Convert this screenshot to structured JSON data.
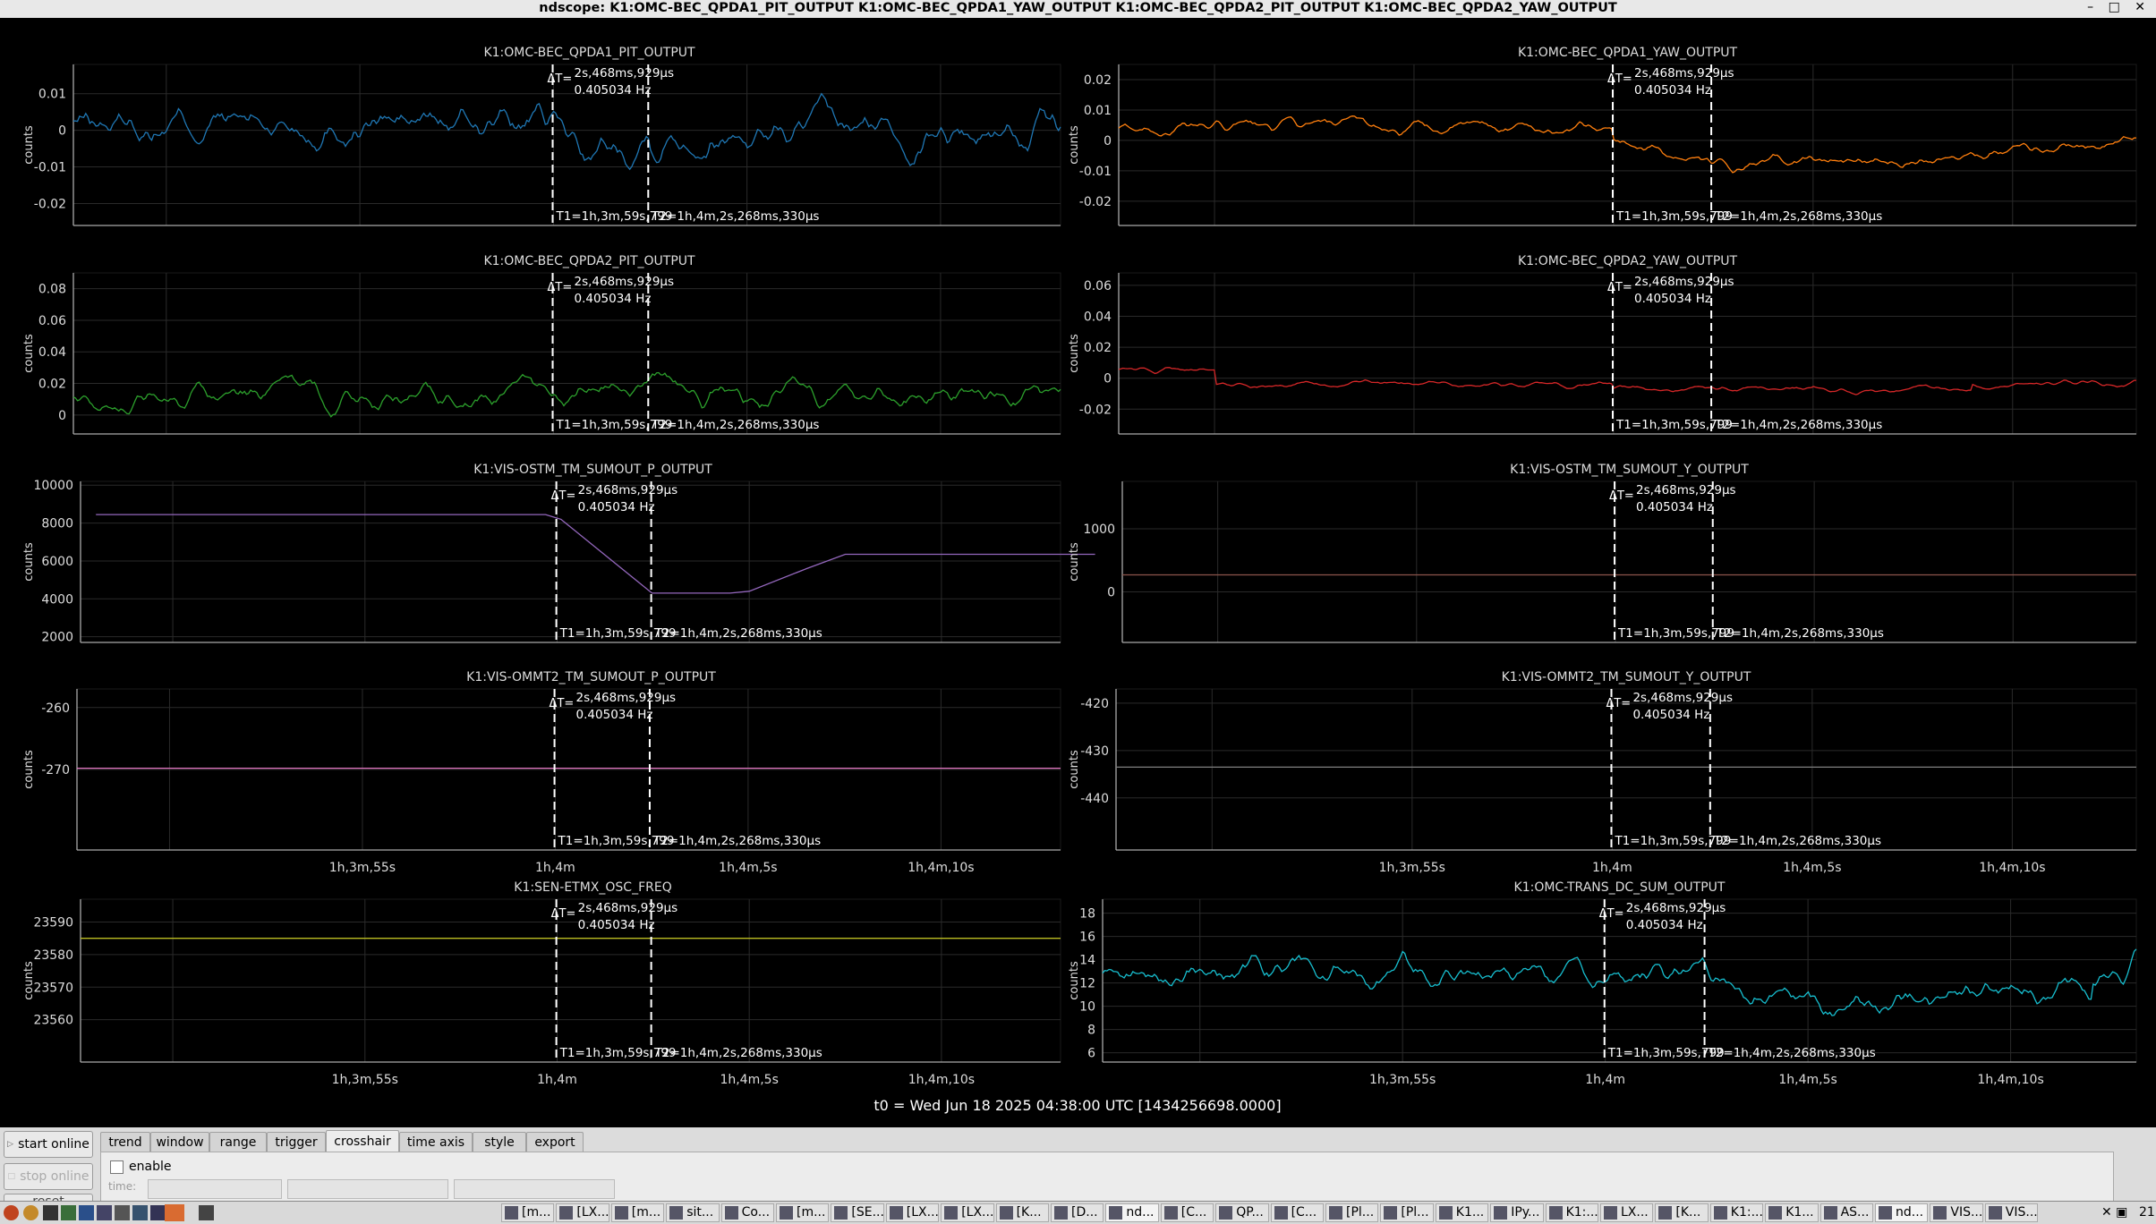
{
  "window": {
    "title": "ndscope: K1:OMC-BEC_QPDA1_PIT_OUTPUT K1:OMC-BEC_QPDA1_YAW_OUTPUT K1:OMC-BEC_QPDA2_PIT_OUTPUT K1:OMC-BEC_QPDA2_YAW_OUTPUT",
    "controls": "– □ ✕"
  },
  "colors": {
    "blue": "#1f77b4",
    "orange": "#ff7f0e",
    "green": "#2ca02c",
    "red": "#d62728",
    "purple": "#9467bd",
    "brown": "#8c564b",
    "pink": "#e377c2",
    "gray": "#7f7f7f",
    "olive": "#bcbd22",
    "cyan": "#17becf"
  },
  "crosshair": {
    "delta_label": "ΔT=",
    "delta": "2s,468ms,929µs",
    "freq": "0.405034 Hz",
    "t1": "T1=1h,3m,59s,799",
    "t2": "T2=1h,4m,2s,268ms,330µs"
  },
  "axis_label": "counts",
  "time_ticks": [
    "1h,3m,55s",
    "1h,4m",
    "1h,4m,5s",
    "1h,4m,10s"
  ],
  "t0": "t0 = Wed Jun 18 2025 04:38:00 UTC [1434256698.0000]",
  "chart_data": [
    {
      "type": "line",
      "title": "K1:OMC-BEC_QPDA1_PIT_OUTPUT",
      "series": [
        {
          "name": "K1:OMC-BEC_QPDA1_PIT_OUTPUT",
          "color": "blue",
          "shape": "qpd_pit1",
          "base": 0.002,
          "amp": 0.01
        }
      ],
      "yticks": [
        {
          "v": 0.01,
          "l": "0.01"
        },
        {
          "v": 0,
          "l": "0"
        },
        {
          "v": -0.01,
          "l": "-0.01"
        },
        {
          "v": -0.02,
          "l": "-0.02"
        }
      ],
      "ylim": [
        -0.026,
        0.018
      ],
      "xlabel": "",
      "ylabel": "counts"
    },
    {
      "type": "line",
      "title": "K1:OMC-BEC_QPDA1_YAW_OUTPUT",
      "series": [
        {
          "name": "K1:OMC-BEC_QPDA1_YAW_OUTPUT",
          "color": "orange",
          "shape": "qpd_yaw1",
          "base": 0.004,
          "amp": 0.004
        }
      ],
      "yticks": [
        {
          "v": 0.02,
          "l": "0.02"
        },
        {
          "v": 0.01,
          "l": "0.01"
        },
        {
          "v": 0,
          "l": "0"
        },
        {
          "v": -0.01,
          "l": "-0.01"
        },
        {
          "v": -0.02,
          "l": "-0.02"
        }
      ],
      "ylim": [
        -0.028,
        0.025
      ],
      "xlabel": "",
      "ylabel": "counts"
    },
    {
      "type": "line",
      "title": "K1:OMC-BEC_QPDA2_PIT_OUTPUT",
      "series": [
        {
          "name": "K1:OMC-BEC_QPDA2_PIT_OUTPUT",
          "color": "green",
          "shape": "qpd_pit2",
          "base": 0.012,
          "amp": 0.015
        }
      ],
      "yticks": [
        {
          "v": 0.08,
          "l": "0.08"
        },
        {
          "v": 0.06,
          "l": "0.06"
        },
        {
          "v": 0.04,
          "l": "0.04"
        },
        {
          "v": 0.02,
          "l": "0.02"
        },
        {
          "v": 0,
          "l": "0"
        }
      ],
      "ylim": [
        -0.012,
        0.09
      ],
      "xlabel": "",
      "ylabel": "counts"
    },
    {
      "type": "line",
      "title": "K1:OMC-BEC_QPDA2_YAW_OUTPUT",
      "series": [
        {
          "name": "K1:OMC-BEC_QPDA2_YAW_OUTPUT",
          "color": "red",
          "shape": "qpd_yaw2",
          "base": -0.004,
          "amp": 0.004
        }
      ],
      "yticks": [
        {
          "v": 0.06,
          "l": "0.06"
        },
        {
          "v": 0.04,
          "l": "0.04"
        },
        {
          "v": 0.02,
          "l": "0.02"
        },
        {
          "v": 0,
          "l": "0"
        },
        {
          "v": -0.02,
          "l": "-0.02"
        }
      ],
      "ylim": [
        -0.036,
        0.068
      ],
      "xlabel": "",
      "ylabel": "counts"
    },
    {
      "type": "line",
      "title": "K1:VIS-OSTM_TM_SUMOUT_P_OUTPUT",
      "series": [
        {
          "name": "K1:VIS-OSTM_TM_SUMOUT_P_OUTPUT",
          "color": "purple",
          "shape": "ramp",
          "points": [
            [
              -12,
              8450
            ],
            [
              -0.3,
              8450
            ],
            [
              0.1,
              8200
            ],
            [
              2.47,
              4300
            ],
            [
              4.5,
              4300
            ],
            [
              5.0,
              4400
            ],
            [
              6.5,
              5600
            ],
            [
              7.5,
              6350
            ],
            [
              14,
              6350
            ]
          ]
        }
      ],
      "yticks": [
        {
          "v": 10000,
          "l": "10000"
        },
        {
          "v": 8000,
          "l": "8000"
        },
        {
          "v": 6000,
          "l": "6000"
        },
        {
          "v": 4000,
          "l": "4000"
        },
        {
          "v": 2000,
          "l": "2000"
        }
      ],
      "ylim": [
        1700,
        10200
      ],
      "xlabel": "",
      "ylabel": "counts"
    },
    {
      "type": "line",
      "title": "K1:VIS-OSTM_TM_SUMOUT_Y_OUTPUT",
      "series": [
        {
          "name": "K1:VIS-OSTM_TM_SUMOUT_Y_OUTPUT",
          "color": "brown",
          "shape": "flat",
          "value": 270
        }
      ],
      "yticks": [
        {
          "v": 1000,
          "l": "1000"
        },
        {
          "v": 0,
          "l": "0"
        }
      ],
      "ylim": [
        -800,
        1750
      ],
      "xlabel": "",
      "ylabel": "counts"
    },
    {
      "type": "line",
      "title": "K1:VIS-OMMT2_TM_SUMOUT_P_OUTPUT",
      "series": [
        {
          "name": "K1:VIS-OMMT2_TM_SUMOUT_P_OUTPUT",
          "color": "pink",
          "shape": "flat",
          "value": -269.8
        }
      ],
      "yticks": [
        {
          "v": -260,
          "l": "-260"
        },
        {
          "v": -270,
          "l": "-270"
        }
      ],
      "ylim": [
        -283,
        -257
      ],
      "xlabel": "",
      "ylabel": "counts"
    },
    {
      "type": "line",
      "title": "K1:VIS-OMMT2_TM_SUMOUT_Y_OUTPUT",
      "series": [
        {
          "name": "K1:VIS-OMMT2_TM_SUMOUT_Y_OUTPUT",
          "color": "gray",
          "shape": "flat",
          "value": -433.5
        }
      ],
      "yticks": [
        {
          "v": -420,
          "l": "-420"
        },
        {
          "v": -430,
          "l": "-430"
        },
        {
          "v": -440,
          "l": "-440"
        }
      ],
      "ylim": [
        -451,
        -417
      ],
      "xlabel": "",
      "ylabel": "counts"
    },
    {
      "type": "line",
      "title": "K1:SEN-ETMX_OSC_FREQ",
      "series": [
        {
          "name": "K1:SEN-ETMX_OSC_FREQ",
          "color": "olive",
          "shape": "flat",
          "value": 23585
        }
      ],
      "yticks": [
        {
          "v": 23590,
          "l": "23590"
        },
        {
          "v": 23580,
          "l": "23580"
        },
        {
          "v": 23570,
          "l": "23570"
        },
        {
          "v": 23560,
          "l": "23560"
        }
      ],
      "ylim": [
        23547,
        23597
      ],
      "xlabel": "",
      "ylabel": "counts"
    },
    {
      "type": "line",
      "title": "K1:OMC-TRANS_DC_SUM_OUTPUT",
      "series": [
        {
          "name": "K1:OMC-TRANS_DC_SUM_OUTPUT",
          "color": "cyan",
          "shape": "trans_dc",
          "base": 13,
          "amp": 1.7
        }
      ],
      "yticks": [
        {
          "v": 18,
          "l": "18"
        },
        {
          "v": 16,
          "l": "16"
        },
        {
          "v": 14,
          "l": "14"
        },
        {
          "v": 12,
          "l": "12"
        },
        {
          "v": 10,
          "l": "10"
        },
        {
          "v": 8,
          "l": "8"
        },
        {
          "v": 6,
          "l": "6"
        }
      ],
      "ylim": [
        5.2,
        19.2
      ],
      "xlabel": "",
      "ylabel": "counts"
    }
  ],
  "controls": {
    "start_online": "start online",
    "stop_online": "stop online",
    "reset": "reset",
    "tabs": [
      "trend",
      "window",
      "range",
      "trigger",
      "crosshair",
      "time axis",
      "style",
      "export"
    ],
    "active_tab": "crosshair",
    "enable_label": "enable",
    "time_label": "time:"
  },
  "taskbar": {
    "tasks": [
      "[m...",
      "[LX...",
      "[m...",
      "sit...",
      "Co...",
      "[m...",
      "[SE...",
      "[LX...",
      "[LX...",
      "[K...",
      "[D...",
      "nd...",
      "[C...",
      "QP...",
      "[C...",
      "[Pl...",
      "[Pl...",
      "K1...",
      "IPy...",
      "K1:...",
      "LX...",
      "[K...",
      "K1:...",
      "K1...",
      "AS...",
      "nd...",
      "VIS...",
      "VIS..."
    ],
    "clock": "21"
  }
}
